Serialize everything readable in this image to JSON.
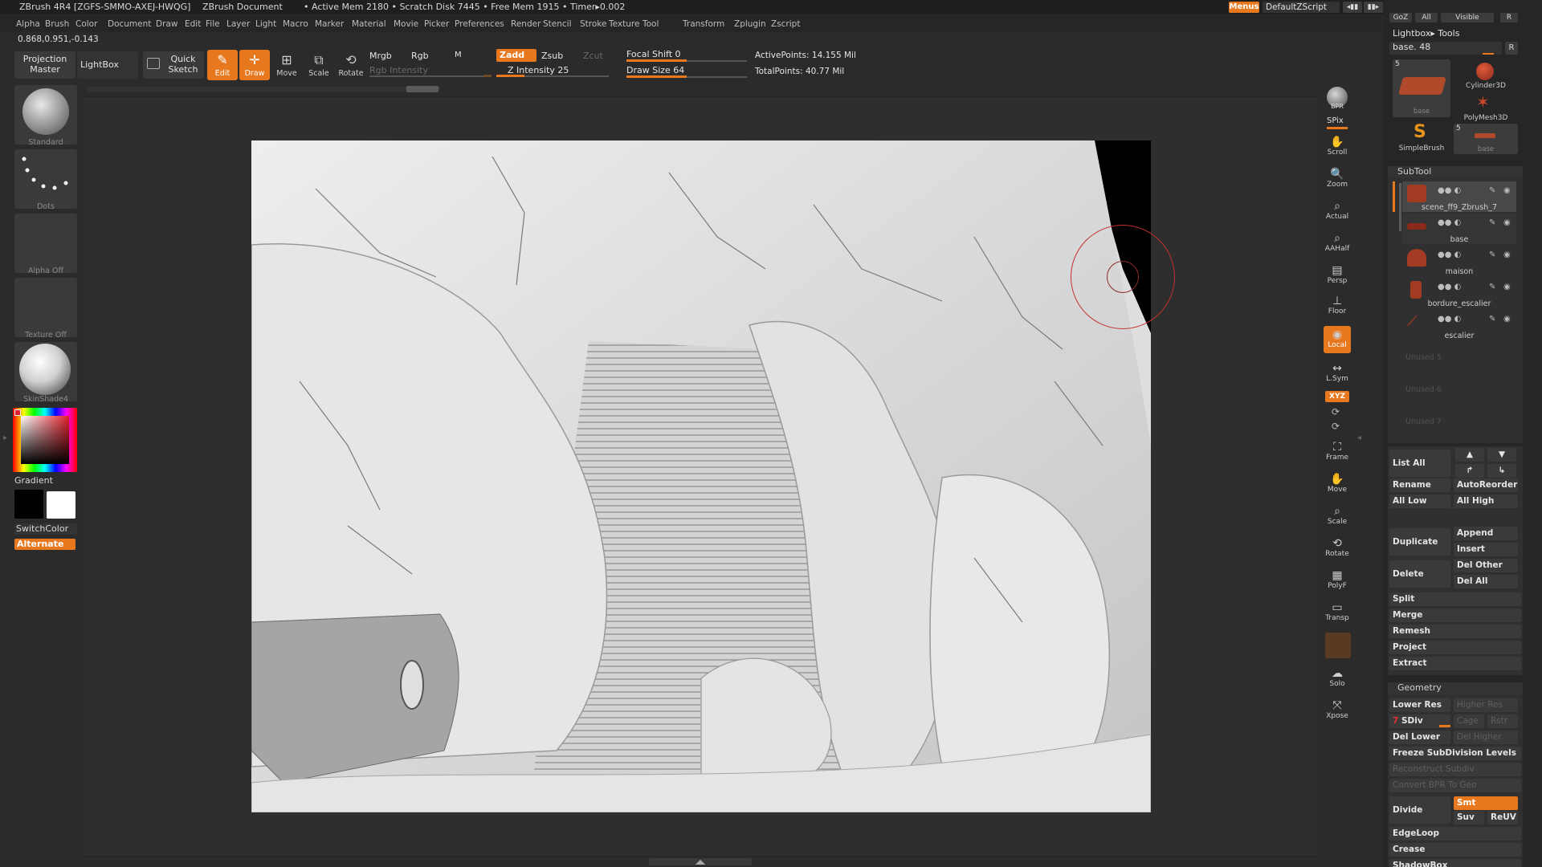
{
  "titlebar": {
    "app": "ZBrush 4R4 [ZGFS-SMMO-AXEJ-HWQG]",
    "document": "ZBrush Document",
    "stats": "• Active Mem 2180 • Scratch Disk 7445 • Free Mem 1915 • Timer▸0.002",
    "menus_btn": "Menus",
    "script": "DefaultZScript"
  },
  "menubar": [
    "Alpha",
    "Brush",
    "Color",
    "Document",
    "Draw",
    "Edit",
    "File",
    "Layer",
    "Light",
    "Macro",
    "Marker",
    "Material",
    "Movie",
    "Picker",
    "Preferences",
    "Render",
    "Stencil",
    "Stroke",
    "Texture",
    "Tool",
    "Transform",
    "Zplugin",
    "Zscript"
  ],
  "coords": "0.868,0.951,-0.143",
  "shelf": {
    "projection_master": "Projection Master",
    "lightbox": "LightBox",
    "quick_sketch": "Quick Sketch",
    "tools": [
      {
        "label": "Edit",
        "icon": "edit-icon",
        "active": true
      },
      {
        "label": "Draw",
        "icon": "draw-icon",
        "active": true
      },
      {
        "label": "Move",
        "icon": "move-icon",
        "active": false
      },
      {
        "label": "Scale",
        "icon": "scale-icon",
        "active": false
      },
      {
        "label": "Rotate",
        "icon": "rotate-icon",
        "active": false
      }
    ],
    "mrgb": "Mrgb",
    "rgb": "Rgb",
    "m": "M",
    "rgb_intensity": "Rgb Intensity",
    "zadd": "Zadd",
    "zsub": "Zsub",
    "zcut": "Zcut",
    "z_intensity": "Z Intensity 25",
    "z_intensity_value": 0.25,
    "focal_shift": "Focal Shift 0",
    "focal_shift_value": 0.5,
    "draw_size": "Draw Size 64",
    "draw_size_value": 0.5,
    "active_points": "ActivePoints: 14.155 Mil",
    "total_points": "TotalPoints: 40.77 Mil"
  },
  "leftshelf": {
    "brush": "Standard",
    "stroke": "Dots",
    "alpha": "Alpha Off",
    "texture": "Texture Off",
    "material": "SkinShade4",
    "gradient": "Gradient",
    "switchcolor": "SwitchColor",
    "alternate": "Alternate"
  },
  "rightshelf": [
    "BPR",
    "SPix",
    "Scroll",
    "Zoom",
    "Actual",
    "AAHalf",
    "Persp",
    "Floor",
    "Local",
    "L.Sym",
    "XYZ",
    "Frame",
    "Move",
    "Scale",
    "Rotate",
    "PolyF",
    "Transp",
    "Solo",
    "Xpose"
  ],
  "rpanel": {
    "top_btns": [
      "GoZ",
      "All",
      "Visible",
      "R"
    ],
    "lightbox_tools": "Lightbox▸ Tools",
    "tool_name": "base. 48",
    "r": "R",
    "tools": [
      {
        "label": "base",
        "count": "5"
      },
      {
        "label": "Cylinder3D"
      },
      {
        "label": "PolyMesh3D"
      },
      {
        "label": "SimpleBrush"
      },
      {
        "label": "base",
        "count": "5"
      }
    ],
    "subtool_title": "SubTool",
    "subtools": [
      "scene_ff9_Zbrush_7",
      "base",
      "maison",
      "bordure_escalier",
      "escalier"
    ],
    "unused": [
      "Unused 5",
      "Unused 6",
      "Unused 7"
    ],
    "list_all": "List All",
    "rename": "Rename",
    "autoreorder": "AutoReorder",
    "all_low": "All Low",
    "all_high": "All High",
    "append": "Append",
    "insert": "Insert",
    "duplicate": "Duplicate",
    "delete": "Delete",
    "del_other": "Del Other",
    "del_all": "Del All",
    "split": "Split",
    "merge": "Merge",
    "remesh": "Remesh",
    "project": "Project",
    "extract": "Extract",
    "geometry_title": "Geometry",
    "lower_res": "Lower Res",
    "higher_res": "Higher Res",
    "sdiv_num": "7",
    "sdiv": "SDiv",
    "cage": "Cage",
    "rstr": "Rstr",
    "del_lower": "Del Lower",
    "del_higher": "Del Higher",
    "freeze": "Freeze SubDivision Levels",
    "reconstruct": "Reconstruct Subdiv",
    "convert_bpr": "Convert BPR To Geo",
    "divide": "Divide",
    "smt": "Smt",
    "suv": "Suv",
    "reuv": "ReUV",
    "edgeloop": "EdgeLoop",
    "crease": "Crease",
    "shadowbox": "ShadowBox"
  },
  "colors": {
    "accent": "#e8781e",
    "panel": "#262626",
    "canvas": "#2e2e2e"
  }
}
